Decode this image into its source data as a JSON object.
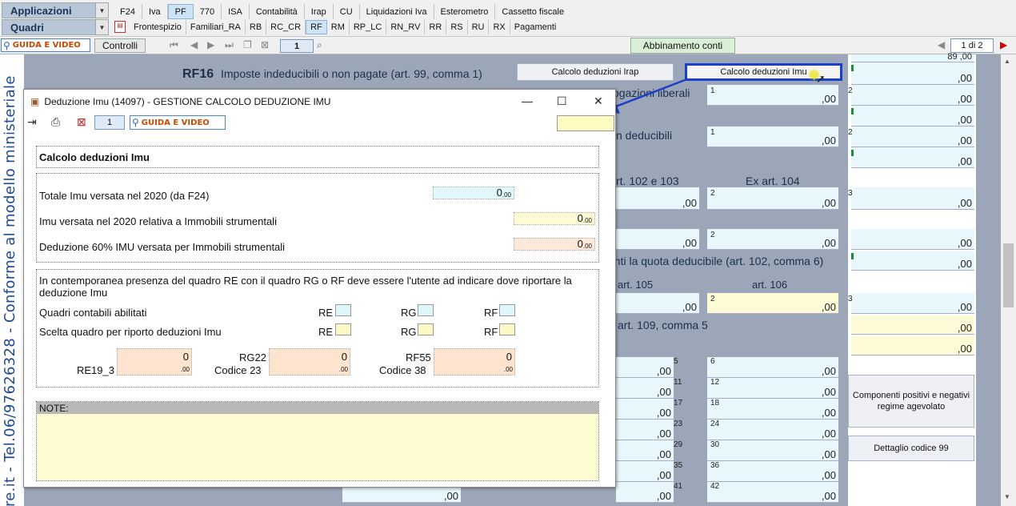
{
  "top": {
    "applicazioni": "Applicazioni",
    "quadri": "Quadri",
    "tabs": [
      "F24",
      "Iva",
      "PF",
      "770",
      "ISA",
      "Contabilità",
      "Irap",
      "CU",
      "Liquidazioni Iva",
      "Esterometro",
      "Cassetto fiscale"
    ],
    "subtabs": [
      "Frontespizio",
      "Familiari_RA",
      "RB",
      "RC_CR",
      "RF",
      "RM",
      "RP_LC",
      "RN_RV",
      "RR",
      "RS",
      "RU",
      "RX",
      "Pagamenti"
    ]
  },
  "toolbar": {
    "guida_video": "GUIDA E VIDEO",
    "controlli": "Controlli",
    "page_num": "1",
    "abbinamento": "Abbinamento conti",
    "pager": "1 di 2"
  },
  "left_vertical_text": "re.it - Tel.06/97626328 - Conforme al modello ministeriale",
  "background": {
    "rf16_code": "RF16",
    "rf16_label": "Imposte indeducibili o non pagate (art. 99, comma 1)",
    "btn_irap": "Calcolo deduzioni Irap",
    "btn_imu": "Calcolo deduzioni Imu",
    "erogazioni": "Erogazioni liberali",
    "non_deducibili": "n deducibili",
    "art102": "rt. 102 e 103",
    "art104": "Ex art. 104",
    "quota_deducibile": "enti la quota deducibile (art. 102, comma 6)",
    "art105": "art. 105",
    "art106": "art. 106",
    "art109": "art. 109, comma 5",
    "btn_componenti": "Componenti positivi e negativi regime agevolato",
    "btn_dettaglio": "Dettaglio codice 99",
    "zero": ",00",
    "top_partial": "89 ,00",
    "codes_right": [
      "1",
      "2",
      "1",
      "2",
      "2",
      "3",
      "2",
      "3",
      "2",
      "3",
      "5",
      "6",
      "11",
      "12",
      "17",
      "18",
      "23",
      "24",
      "29",
      "30",
      "35",
      "36",
      "41",
      "42"
    ]
  },
  "dialog": {
    "title": "Deduzione Imu (14097) - GESTIONE CALCOLO DEDUZIONE IMU",
    "page_num": "1",
    "guida_video": "GUIDA E VIDEO",
    "section_title": "Calcolo deduzioni Imu",
    "totale_label": "Totale Imu versata nel 2020 (da F24)",
    "totale_value": "0",
    "strumentali_label": "Imu versata nel 2020 relativa a Immobili strumentali",
    "strumentali_value": "0",
    "deduzione_label": "Deduzione 60% IMU versata per Immobili strumentali",
    "deduzione_value": "0",
    "decimals": ".00",
    "info_text": "In contemporanea presenza del quadro RE con il quadro RG o RF deve essere l'utente ad indicare dove riportare la deduzione Imu",
    "quadri_abilitati": "Quadri contabili abilitati",
    "scelta_quadro": "Scelta quadro per riporto deduzioni Imu",
    "re": "RE",
    "rg": "RG",
    "rf": "RF",
    "re19_label": "RE19_3",
    "re19_value": "0",
    "rg22_label1": "RG22",
    "rg22_label2": "Codice 23",
    "rg22_value": "0",
    "rf55_label1": "RF55",
    "rf55_label2": "Codice 38",
    "rf55_value": "0",
    "note_label": "NOTE:"
  }
}
